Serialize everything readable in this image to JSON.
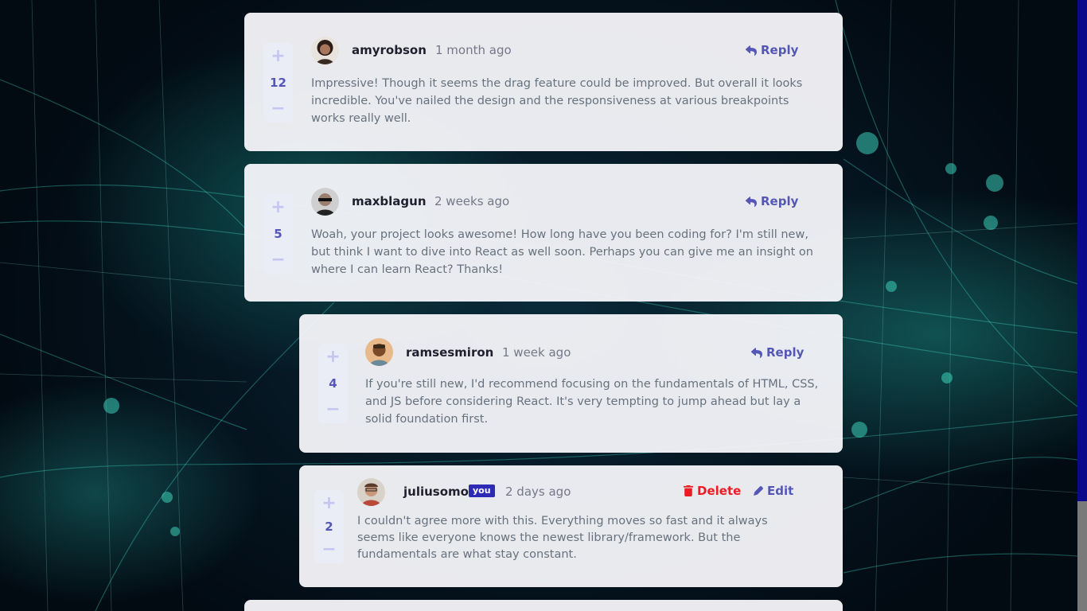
{
  "comments": [
    {
      "username": "amyrobson",
      "time": "1 month ago",
      "score": "12",
      "content": "Impressive! Though it seems the drag feature could be improved. But overall it looks incredible. You've nailed the design and the responsiveness at various breakpoints works really well.",
      "action": "Reply",
      "avatar_color": "#8a6a5a"
    },
    {
      "username": "maxblagun",
      "time": "2 weeks ago",
      "score": "5",
      "content": "Woah, your project looks awesome! How long have you been coding for? I'm still new, but think I want to dive into React as well soon. Perhaps you can give me an insight on where I can learn React? Thanks!",
      "action": "Reply",
      "avatar_color": "#3b3b3b"
    }
  ],
  "replies": [
    {
      "username": "ramsesmiron",
      "time": "1 week ago",
      "score": "4",
      "content": "If you're still new, I'd recommend focusing on the fundamentals of HTML, CSS, and JS before considering React. It's very tempting to jump ahead but lay a solid foundation first.",
      "action": "Reply",
      "avatar_color": "#c98a4e"
    },
    {
      "username": "juliusomo",
      "badge": "you",
      "time": "2 days ago",
      "score": "2",
      "content": "I couldn't agree more with this. Everything moves so fast and it always seems like everyone knows the newest library/framework. But the fundamentals are what stay constant.",
      "delete_label": "Delete",
      "edit_label": "Edit",
      "avatar_color": "#7a5a4a"
    }
  ],
  "vote": {
    "plus": "+",
    "minus": "−"
  },
  "colors": {
    "primary": "#5457b6",
    "danger": "#ed1c24",
    "badge": "#2d2ab5",
    "card": "#f5f6fa"
  }
}
